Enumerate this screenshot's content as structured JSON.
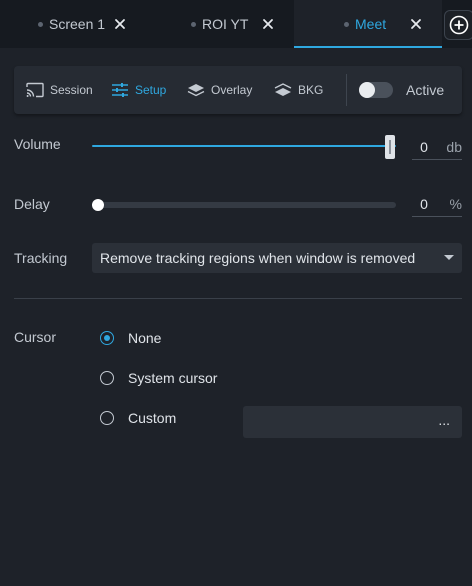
{
  "tabs": [
    {
      "label": "Screen 1",
      "active": false
    },
    {
      "label": "ROI YT",
      "active": false
    },
    {
      "label": "Meet",
      "active": true
    }
  ],
  "toolbar": {
    "session": "Session",
    "setup": "Setup",
    "overlay": "Overlay",
    "bkg": "BKG",
    "active_label": "Active",
    "active_on": false
  },
  "volume": {
    "label": "Volume",
    "value": "0",
    "unit": "db",
    "level": 1.0
  },
  "delay": {
    "label": "Delay",
    "value": "0",
    "unit": "%",
    "level": 0.0
  },
  "tracking": {
    "label": "Tracking",
    "selected": "Remove tracking regions when window is removed"
  },
  "cursor": {
    "label": "Cursor",
    "options": [
      {
        "label": "None",
        "checked": true
      },
      {
        "label": "System cursor",
        "checked": false
      },
      {
        "label": "Custom",
        "checked": false
      }
    ],
    "custom_browse": "..."
  },
  "colors": {
    "accent": "#2fa8e0",
    "background": "#1e2229",
    "panel": "#262b33"
  }
}
